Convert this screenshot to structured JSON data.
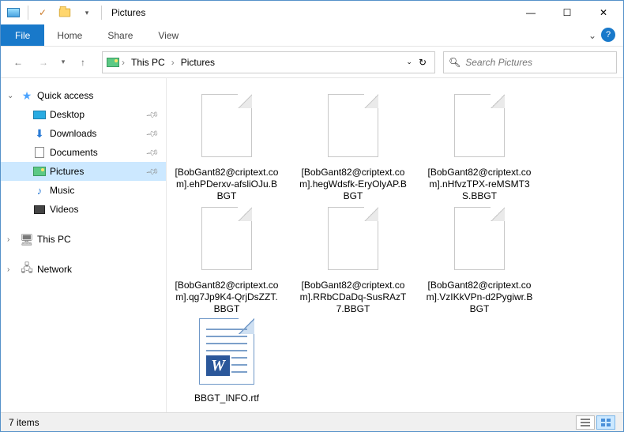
{
  "title": "Pictures",
  "ribbon": {
    "file": "File",
    "home": "Home",
    "share": "Share",
    "view": "View"
  },
  "breadcrumb": {
    "root": "This PC",
    "current": "Pictures"
  },
  "search": {
    "placeholder": "Search Pictures"
  },
  "sidebar": {
    "quick": "Quick access",
    "items": [
      {
        "label": "Desktop"
      },
      {
        "label": "Downloads"
      },
      {
        "label": "Documents"
      },
      {
        "label": "Pictures"
      },
      {
        "label": "Music"
      },
      {
        "label": "Videos"
      }
    ],
    "thispc": "This PC",
    "network": "Network"
  },
  "files": [
    {
      "name": "[BobGant82@criptext.com].ehPDerxv-afsliOJu.BBGT",
      "type": "blank"
    },
    {
      "name": "[BobGant82@criptext.com].hegWdsfk-EryOlyAP.BBGT",
      "type": "blank"
    },
    {
      "name": "[BobGant82@criptext.com].nHfvzTPX-reMSMT3S.BBGT",
      "type": "blank"
    },
    {
      "name": "[BobGant82@criptext.com].qg7Jp9K4-QrjDsZZT.BBGT",
      "type": "blank"
    },
    {
      "name": "[BobGant82@criptext.com].RRbCDaDq-SusRAzT7.BBGT",
      "type": "blank"
    },
    {
      "name": "[BobGant82@criptext.com].VzIKkVPn-d2Pygiwr.BBGT",
      "type": "blank"
    },
    {
      "name": "BBGT_INFO.rtf",
      "type": "rtf"
    }
  ],
  "status": {
    "count": "7 items"
  }
}
